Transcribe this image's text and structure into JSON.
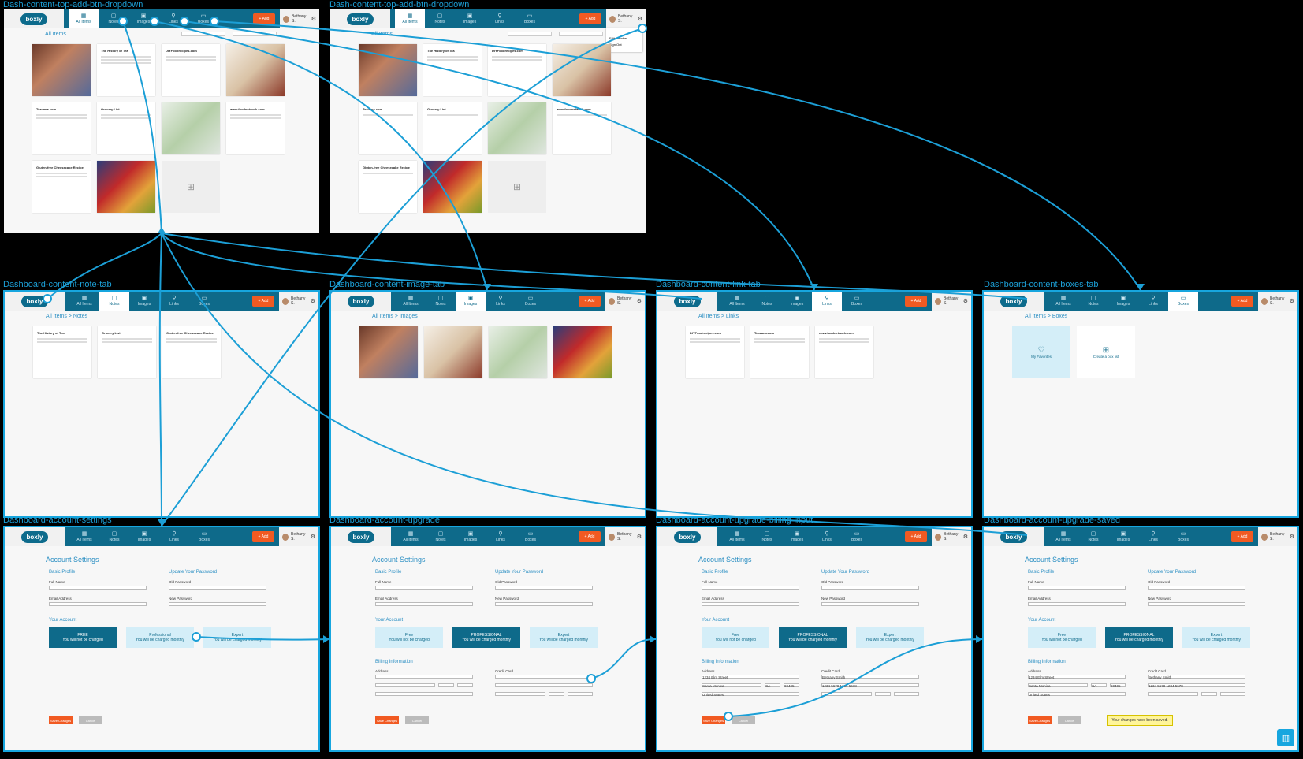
{
  "app": {
    "logo": "boxly",
    "add_label": "+ Add",
    "user_name": "Bethany S.",
    "gear_icon": "gear-icon",
    "tabs": [
      "All Items",
      "Notes",
      "Images",
      "Links",
      "Boxes"
    ]
  },
  "frames": {
    "f1": {
      "label": "Dash-content-top-add-btn-dropdown",
      "breadcrumb": "All Items"
    },
    "f2": {
      "label": "Dash-content-top-add-btn-dropdown",
      "breadcrumb": "All Items"
    },
    "f3": {
      "label": "Dashboard-content-note-tab",
      "breadcrumb": "All Items > Notes"
    },
    "f4": {
      "label": "Dashboard-content-image-tab",
      "breadcrumb": "All Items > Images"
    },
    "f5": {
      "label": "Dashboard-content-link-tab",
      "breadcrumb": "All Items > Links"
    },
    "f6": {
      "label": "Dashboard-content-boxes-tab",
      "breadcrumb": "All Items > Boxes"
    },
    "f7": {
      "label": "Dashboard-account-settings"
    },
    "f8": {
      "label": "Dashboard-account-upgrade"
    },
    "f9": {
      "label": "Dashboard-account-upgrade-billing-input"
    },
    "f10": {
      "label": "Dashboard-account-upgrade-saved"
    }
  },
  "cards": {
    "tea_history": "The History of Tea",
    "diy_food": "DIYFoodrecipes.com",
    "teavana": "Teavana.com",
    "grocery": "Grocery List",
    "foodnetwork": "www.foodnetwork.com",
    "cheesecake": "Gluten-free Cheesecake Recipe"
  },
  "dropdown": {
    "item1": "Edit Member",
    "item2": "Sign Out"
  },
  "boxes": {
    "favorites": "My Favorites",
    "create": "Create a box list"
  },
  "account": {
    "title": "Account Settings",
    "basic_profile": "Basic Profile",
    "full_name": "Full Name",
    "email": "Email Address",
    "update_password": "Update Your Password",
    "old_password": "Old Password",
    "new_password": "New Password",
    "your_account": "Your Account",
    "billing": "Billing Information",
    "address": "Address",
    "credit_card": "Credit Card",
    "save": "Save Changes",
    "cancel": "Cancel",
    "saved_msg": "Your changes have been saved."
  },
  "plans": {
    "free": "FREE",
    "free_sub": "You will not be charged",
    "professional": "Professional",
    "professional_sel": "PROFESSIONAL",
    "expert": "Expert",
    "free_alt": "Free",
    "sub": "You will be charged monthly"
  },
  "billing_values": {
    "address1": "1234 Elm Street",
    "city": "Santa Monica",
    "state": "CA",
    "zip": "90405",
    "country": "United States",
    "name_on_card": "Bethany Smith",
    "card": "1234 5678 1234 5678"
  },
  "colors": {
    "brand": "#0e6a8a",
    "accent": "#f15a22",
    "wire": "#1c9fd6"
  }
}
